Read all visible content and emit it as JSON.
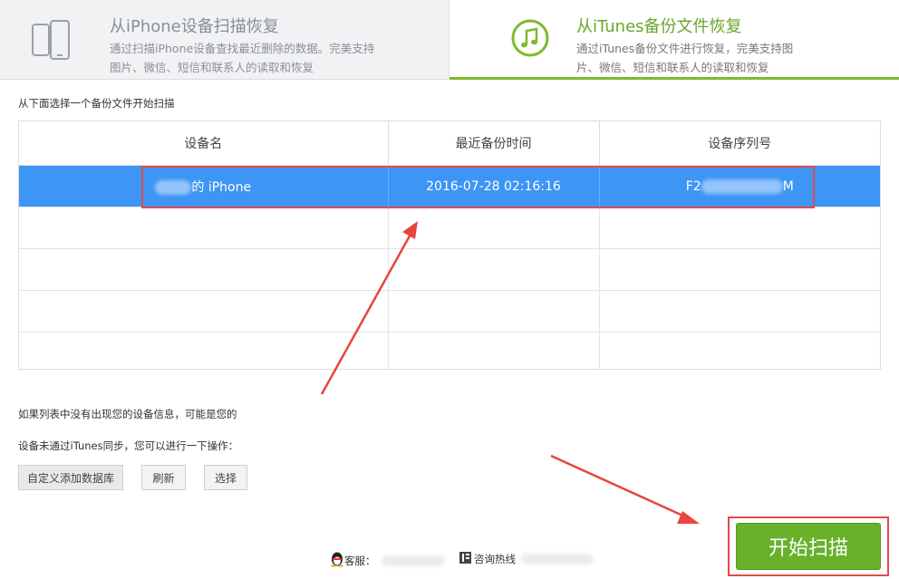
{
  "tabs": {
    "iphone": {
      "title": "从iPhone设备扫描恢复",
      "desc": "通过扫描iPhone设备查找最近删除的数据。完美支持图片、微信、短信和联系人的读取和恢复"
    },
    "itunes": {
      "title": "从iTunes备份文件恢复",
      "desc": "通过iTunes备份文件进行恢复，完美支持图片、微信、短信和联系人的读取和恢复"
    }
  },
  "instruction": "从下面选择一个备份文件开始扫描",
  "table": {
    "headers": [
      "设备名",
      "最近备份时间",
      "设备序列号"
    ],
    "selected_row": {
      "device_suffix": "的 iPhone",
      "backup_time": "2016-07-28  02:16:16",
      "serial_prefix": "F2",
      "serial_suffix": "M"
    }
  },
  "notes": {
    "line1": "如果列表中没有出现您的设备信息，可能是您的",
    "line2": "设备未通过iTunes同步，您可以进行一下操作："
  },
  "buttons": {
    "add_db": "自定义添加数据库",
    "refresh": "刷新",
    "select": "选择",
    "start_scan": "开始扫描"
  },
  "footer": {
    "kefu_label": "客服：",
    "hotline_label": "咨询热线"
  },
  "colors": {
    "accent_green": "#67b12b",
    "selected_blue": "#3d95f5",
    "annotation_red": "#e34a4a"
  }
}
